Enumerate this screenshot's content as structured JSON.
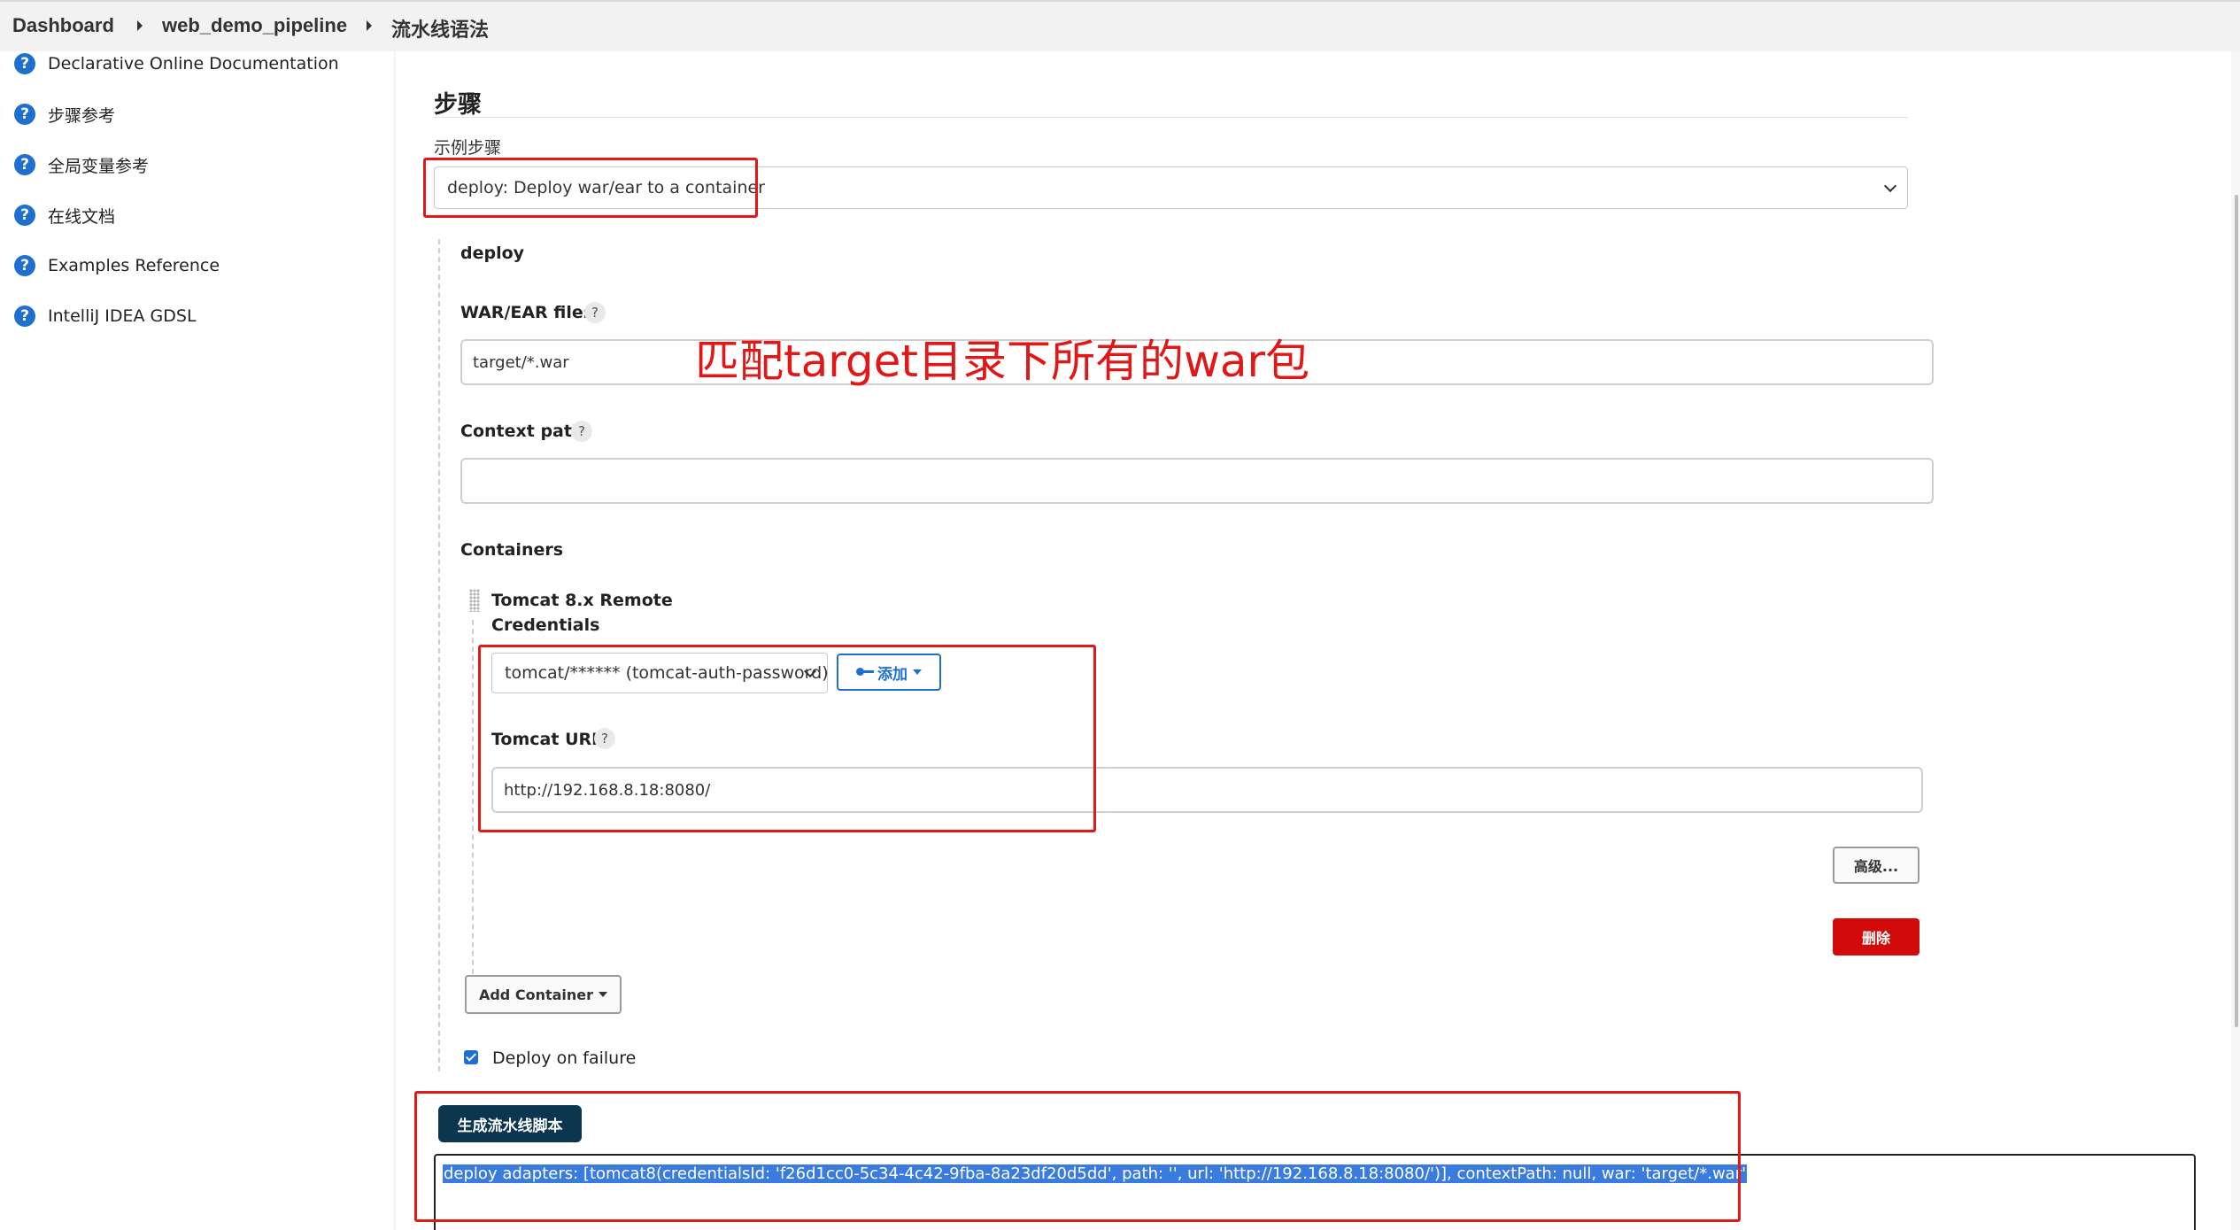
{
  "breadcrumb": {
    "items": [
      "Dashboard",
      "web_demo_pipeline",
      "流水线语法"
    ]
  },
  "sidebar": {
    "items": [
      {
        "label": "Declarative Online Documentation"
      },
      {
        "label": "步骤参考"
      },
      {
        "label": "全局变量参考"
      },
      {
        "label": "在线文档"
      },
      {
        "label": "Examples Reference"
      },
      {
        "label": "IntelliJ IDEA GDSL"
      }
    ]
  },
  "steps": {
    "section_title": "步骤",
    "sample_step_label": "示例步骤",
    "sample_step_value": "deploy: Deploy war/ear to a container",
    "step_name": "deploy",
    "war_files_label": "WAR/EAR files",
    "war_files_value": "target/*.war",
    "context_path_label": "Context path",
    "context_path_value": "",
    "containers_label": "Containers",
    "container": {
      "title": "Tomcat 8.x Remote",
      "credentials_label": "Credentials",
      "credentials_value": "tomcat/****** (tomcat-auth-password)",
      "add_label": "添加",
      "url_label": "Tomcat URL",
      "url_value": "http://192.168.8.18:8080/",
      "advanced_label": "高级...",
      "delete_label": "删除"
    },
    "add_container_label": "Add Container",
    "deploy_on_failure_label": "Deploy on failure",
    "deploy_on_failure_checked": true,
    "generate_label": "生成流水线脚本",
    "generated_script": "deploy adapters: [tomcat8(credentialsId: 'f26d1cc0-5c34-4c42-9fba-8a23df20d5dd', path: '', url: 'http://192.168.8.18:8080/')], contextPath: null, war: 'target/*.war'"
  },
  "help_glyph": "?",
  "annotation": {
    "text": "匹配target目录下所有的war包",
    "color": "#e01818"
  },
  "colors": {
    "accent": "#1f6fd0",
    "danger": "#d10a0a",
    "primary_dark": "#0c3550",
    "selection": "#3a7be0"
  }
}
